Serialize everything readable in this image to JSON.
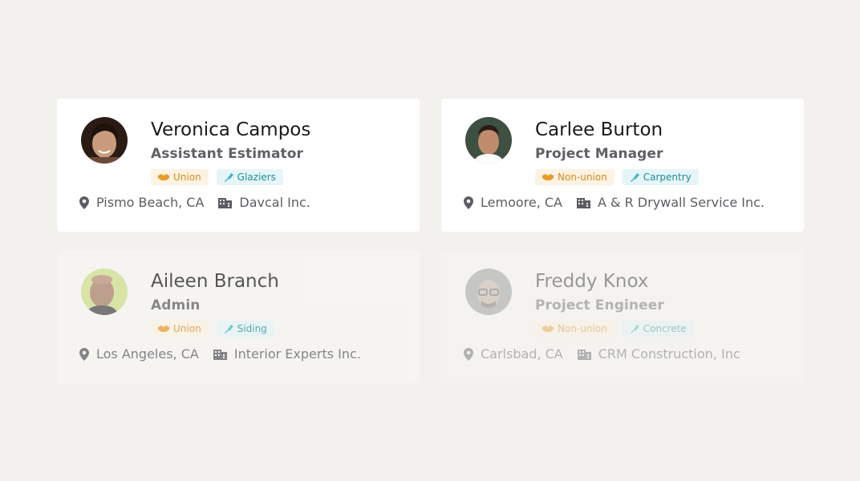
{
  "colors": {
    "background": "#f2f1ee",
    "union_tag_text": "#d98a1e",
    "union_tag_bg": "#fdf3e3",
    "trade_tag_text": "#1f8c9c",
    "trade_tag_bg": "#e6f5f7"
  },
  "cards": [
    {
      "name": "Veronica Campos",
      "role": "Assistant Estimator",
      "union_tag": "Union",
      "trade_tag": "Glaziers",
      "location": "Pismo Beach, CA",
      "company": "Davcal Inc."
    },
    {
      "name": "Carlee Burton",
      "role": "Project Manager",
      "union_tag": "Non-union",
      "trade_tag": "Carpentry",
      "location": "Lemoore, CA",
      "company": "A & R Drywall Service Inc."
    },
    {
      "name": "Aileen Branch",
      "role": "Admin",
      "union_tag": "Union",
      "trade_tag": "Siding",
      "location": "Los Angeles, CA",
      "company": "Interior Experts Inc."
    },
    {
      "name": "Freddy Knox",
      "role": "Project Engineer",
      "union_tag": "Non-union",
      "trade_tag": "Concrete",
      "location": "Carlsbad, CA",
      "company": "CRM Construction, Inc"
    }
  ],
  "icons": {
    "union": "handshake-icon",
    "trade": "trowel-icon",
    "location": "map-pin-icon",
    "company": "building-icon"
  }
}
